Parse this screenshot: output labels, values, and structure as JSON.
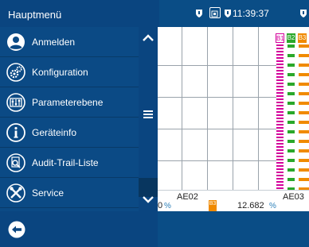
{
  "header": {
    "menu_title": "Hauptmenü",
    "time": "11:39:37"
  },
  "menu": {
    "items": [
      {
        "label": "Anmelden",
        "icon": "user-icon"
      },
      {
        "label": "Konfiguration",
        "icon": "gear-icon"
      },
      {
        "label": "Parameterebene",
        "icon": "parameter-icon"
      },
      {
        "label": "Geräteinfo",
        "icon": "info-icon"
      },
      {
        "label": "Audit-Trail-Liste",
        "icon": "audit-search-icon"
      },
      {
        "label": "Service",
        "icon": "service-tools-icon"
      }
    ],
    "scroll_up": "∧",
    "scroll_handle": "≡",
    "scroll_down": "∨"
  },
  "chart": {
    "bar_tags": [
      "B1",
      "B2",
      "B3"
    ],
    "bar_colors": [
      "#d4009c",
      "#2aa82a",
      "#f08a00"
    ]
  },
  "values": {
    "ae02_label": "AE02",
    "ae02_partial": "0",
    "ae02_unit": "%",
    "ae03_label": "AE03",
    "ae03_value": "12.682",
    "ae03_unit": "%",
    "marker": "B3"
  },
  "colors": {
    "menu_bg": "#0b4a85",
    "topbar": "#0a4d86",
    "accent_orange": "#f08a00"
  }
}
